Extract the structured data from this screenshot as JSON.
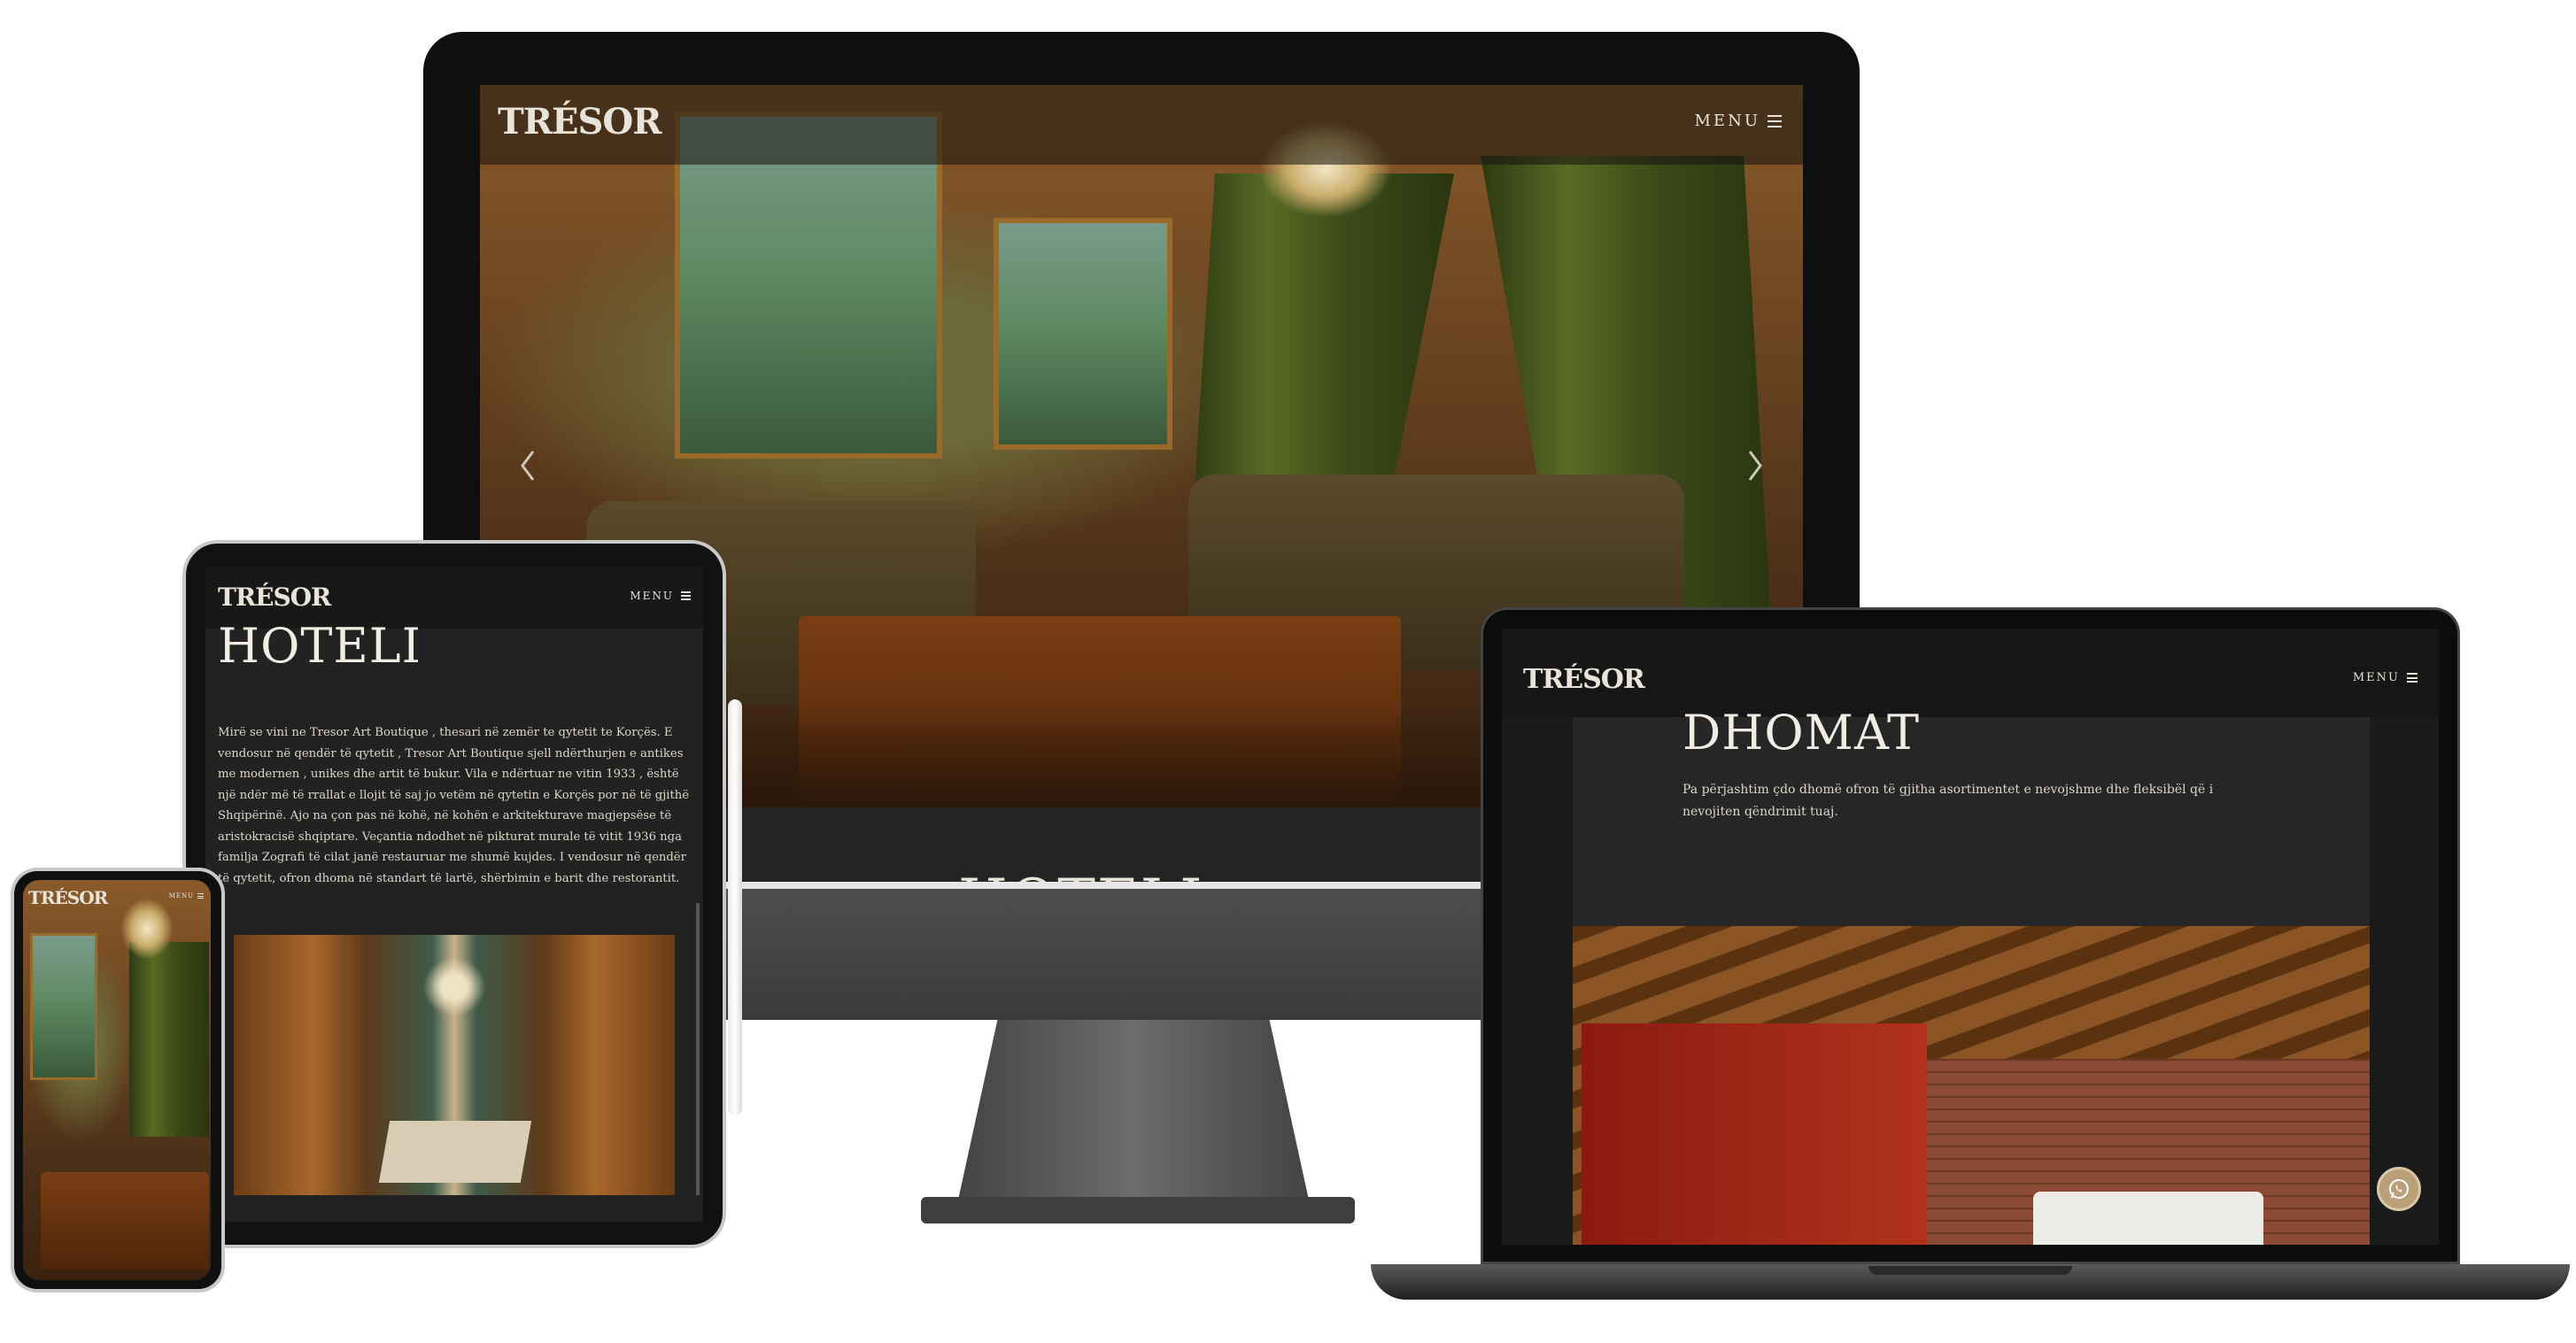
{
  "brand": {
    "logo": "TRÉSOR",
    "accent": "#b9a078",
    "text_color": "#e9e4da"
  },
  "monitor": {
    "menu_label": "MENU",
    "prev_icon": "chevron-left-icon",
    "next_icon": "chevron-right-icon",
    "partial_heading": "HOTELI"
  },
  "tablet": {
    "menu_label": "MENU",
    "heading": "HOTELI",
    "body": "Mirë se vini ne Tresor Art Boutique , thesari në zemër te qytetit te Korçës. E vendosur në qendër të qytetit , Tresor Art Boutique sjell ndërthurjen e antikes me modernen , unikes dhe artit të bukur. Vila e ndërtuar ne vitin 1933 , është një ndër më të rrallat e llojit të saj jo vetëm në qytetin e Korçës por në të gjithë Shqipërinë. Ajo na çon pas në kohë, në kohën e arkitekturave magjepsëse të aristokracisë shqiptare. Veçantia ndodhet në pikturat murale të vitit 1936 nga familja Zografi të cilat janë restauruar me shumë kujdes. I vendosur në qendër të qytetit, ofron dhoma në standart të lartë, shërbimin e barit dhe restorantit."
  },
  "phone": {
    "menu_label": "MENU"
  },
  "laptop": {
    "menu_label": "MENU",
    "heading": "DHOMAT",
    "body": "Pa përjashtim çdo dhomë ofron të gjitha asortimentet e nevojshme dhe fleksibël që i nevojiten qëndrimit tuaj.",
    "chat_icon": "whatsapp-icon"
  }
}
